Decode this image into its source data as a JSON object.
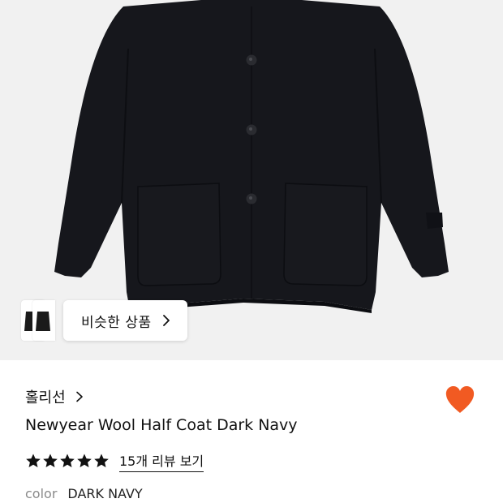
{
  "product": {
    "image_alt": "Newyear Wool Half Coat Dark Navy",
    "brand": "홀리선",
    "title": "Newyear Wool Half Coat Dark Navy",
    "review_link": "15개 리뷰 보기",
    "rating": 5,
    "rating_max": 5,
    "color_label": "color",
    "color_value": "DARK NAVY",
    "liked": true
  },
  "similar": {
    "label": "비슷한 상품"
  },
  "colors": {
    "heart": "#f15a22",
    "image_bg": "#f1f1f1",
    "coat": "#16171c",
    "text": "#111111",
    "muted": "#8a8a8a"
  },
  "icons": {
    "similar_chevron": "chevron-right-icon",
    "brand_chevron": "chevron-right-icon",
    "heart": "heart-icon",
    "star": "star-icon"
  }
}
